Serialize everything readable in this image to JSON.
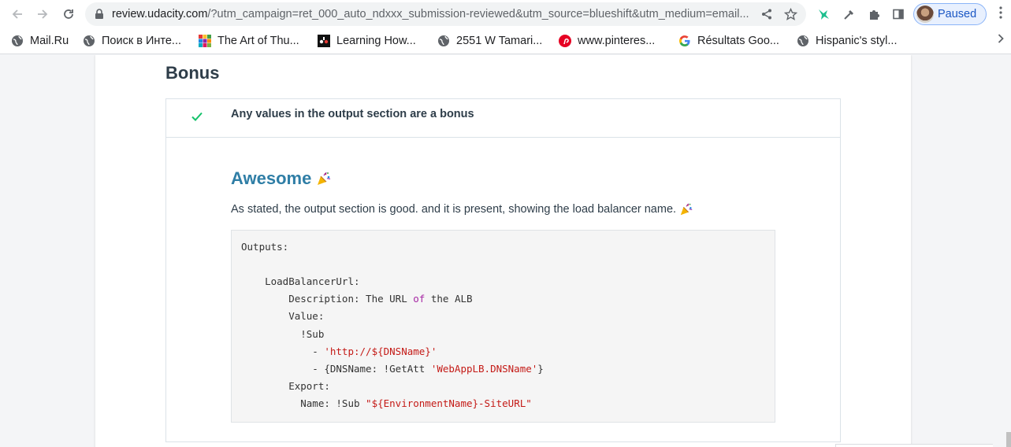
{
  "browser": {
    "url_host": "review.udacity.com",
    "url_path": "/?utm_campaign=ret_000_auto_ndxxx_submission-reviewed&utm_source=blueshift&utm_medium=email...",
    "profile_status": "Paused",
    "icons": {
      "back": "arrow-left-icon",
      "forward": "arrow-right-icon",
      "reload": "reload-icon",
      "lock": "lock-icon",
      "share": "share-icon",
      "bookmark": "star-icon",
      "extension_1": "bird-extension-icon",
      "extension_2": "eyedropper-icon",
      "extensions": "puzzle-icon",
      "side_panel": "side-panel-icon",
      "menu": "kebab-menu-icon"
    }
  },
  "bookmarks": [
    {
      "label": "Mail.Ru",
      "icon": "globe-icon"
    },
    {
      "label": "Поиск в Инте...",
      "icon": "globe-icon"
    },
    {
      "label": "The Art of Thu...",
      "icon": "grid-colorful-icon"
    },
    {
      "label": "Learning How...",
      "icon": "cbc-logo-icon"
    },
    {
      "label": "2551 W Tamari...",
      "icon": "globe-icon"
    },
    {
      "label": "www.pinteres...",
      "icon": "pinterest-icon"
    },
    {
      "label": "Résultats Goo...",
      "icon": "google-icon"
    },
    {
      "label": "Hispanic's styl...",
      "icon": "globe-icon"
    }
  ],
  "page": {
    "section_title": "Bonus",
    "criterion": "Any values in the output section are a bonus",
    "feedback_title": "Awesome",
    "feedback_text": "As stated, the output section is good. and it is present, showing the load balancer name.",
    "code_lines": [
      "Outputs:",
      "",
      "    LoadBalancerUrl:",
      "        Description: The URL of the ALB",
      "        Value:",
      "          !Sub",
      "            - 'http://${DNSName}'",
      "            - {DNSName: !GetAtt 'WebAppLB.DNSName'}",
      "        Export:",
      "          Name: !Sub \"${EnvironmentName}-SiteURL\""
    ],
    "colors": {
      "accent_title": "#2f7ea6",
      "check": "#02b3e4",
      "code_keyword": "#a626a4",
      "code_string": "#c41a16"
    }
  }
}
